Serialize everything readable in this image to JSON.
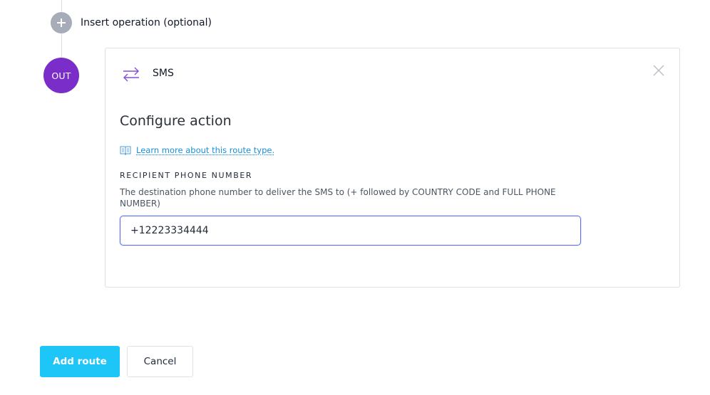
{
  "insert_operation": {
    "label": "Insert operation (optional)",
    "icon": "plus-icon"
  },
  "out_badge": {
    "label": "OUT",
    "color": "#7a2dc9"
  },
  "action_card": {
    "icon": "transfer-arrows-icon",
    "title": "SMS",
    "close_icon": "close-icon",
    "section_title": "Configure action",
    "learn_more": {
      "icon": "book-icon",
      "text": "Learn more about this route type."
    },
    "recipient": {
      "label": "RECIPIENT PHONE NUMBER",
      "help": "The destination phone number to deliver the SMS to (+ followed by COUNTRY CODE and FULL PHONE NUMBER)",
      "value": "+12223334444"
    }
  },
  "footer": {
    "add_route_label": "Add route",
    "cancel_label": "Cancel",
    "accent_color": "#1ec5f7"
  }
}
